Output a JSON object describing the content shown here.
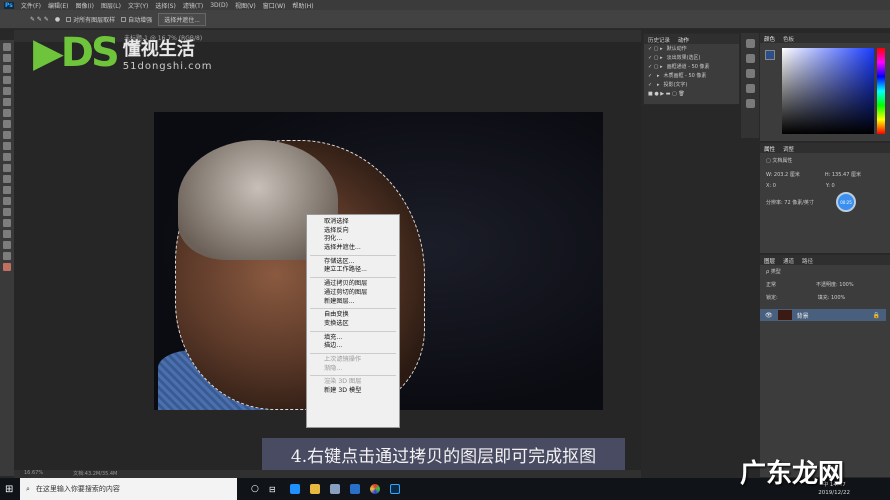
{
  "menubar": {
    "app": "Ps",
    "items": [
      "文件(F)",
      "编辑(E)",
      "图像(I)",
      "图层(L)",
      "文字(Y)",
      "选择(S)",
      "滤镜(T)",
      "3D(D)",
      "视图(V)",
      "窗口(W)",
      "帮助(H)"
    ]
  },
  "options": {
    "sample_all_layers": "对所有图层取样",
    "auto_enhance": "自动增强",
    "select_and_mask": "选择并遮住..."
  },
  "document": {
    "tab": "未标题-1 @ 16.7% (RGB/8)"
  },
  "logo": {
    "mark": "DS",
    "title": "懂视生活",
    "url": "51dongshi.com"
  },
  "context_menu": {
    "groups": [
      [
        {
          "label": "取消选择"
        },
        {
          "label": "选择反向"
        },
        {
          "label": "羽化..."
        },
        {
          "label": "选择并遮住..."
        }
      ],
      [
        {
          "label": "存储选区..."
        },
        {
          "label": "建立工作路径..."
        }
      ],
      [
        {
          "label": "通过拷贝的图层"
        },
        {
          "label": "通过剪切的图层"
        },
        {
          "label": "新建图层..."
        }
      ],
      [
        {
          "label": "自由变换"
        },
        {
          "label": "变换选区"
        }
      ],
      [
        {
          "label": "填充..."
        },
        {
          "label": "描边..."
        }
      ],
      [
        {
          "label": "上次滤镜操作",
          "disabled": true
        },
        {
          "label": "渐隐...",
          "disabled": true
        }
      ],
      [
        {
          "label": "渲染 3D 图层",
          "disabled": true
        },
        {
          "label": "新建 3D 模型"
        }
      ]
    ]
  },
  "caption": "4.右键点击通过拷贝的图层即可完成抠图",
  "status": {
    "zoom": "16.67%",
    "doc": "文档:43.2M/35.4M"
  },
  "actions_panel": {
    "tabs": [
      "历史记录",
      "动作"
    ],
    "rows": [
      "默认动作",
      "淡出效果(选区)",
      "画框通道 - 50 像素",
      "木质画框 - 50 像素",
      "投影(文字)"
    ]
  },
  "color_panel": {
    "tabs": [
      "颜色",
      "色板"
    ],
    "accent": "#1a3cff"
  },
  "properties": {
    "tabs": [
      "属性",
      "调整"
    ],
    "title": "文档属性",
    "w": "W: 203.2 厘米",
    "h": "H: 135.47 厘米",
    "x": "X: 0",
    "y": "Y: 0",
    "resolution": "分辨率: 72 像素/英寸",
    "badge": "00:25"
  },
  "layers": {
    "tabs": [
      "图层",
      "通道",
      "路径"
    ],
    "kind": "类型",
    "mode": "正常",
    "opacity": "不透明度: 100%",
    "lock": "锁定:",
    "fill": "填充: 100%",
    "layer_name": "背景"
  },
  "taskbar": {
    "search_placeholder": "在这里输入你要搜索的内容",
    "time": "14:47",
    "date": "2019/12/22",
    "ime": "中"
  },
  "watermark": "广东龙网"
}
